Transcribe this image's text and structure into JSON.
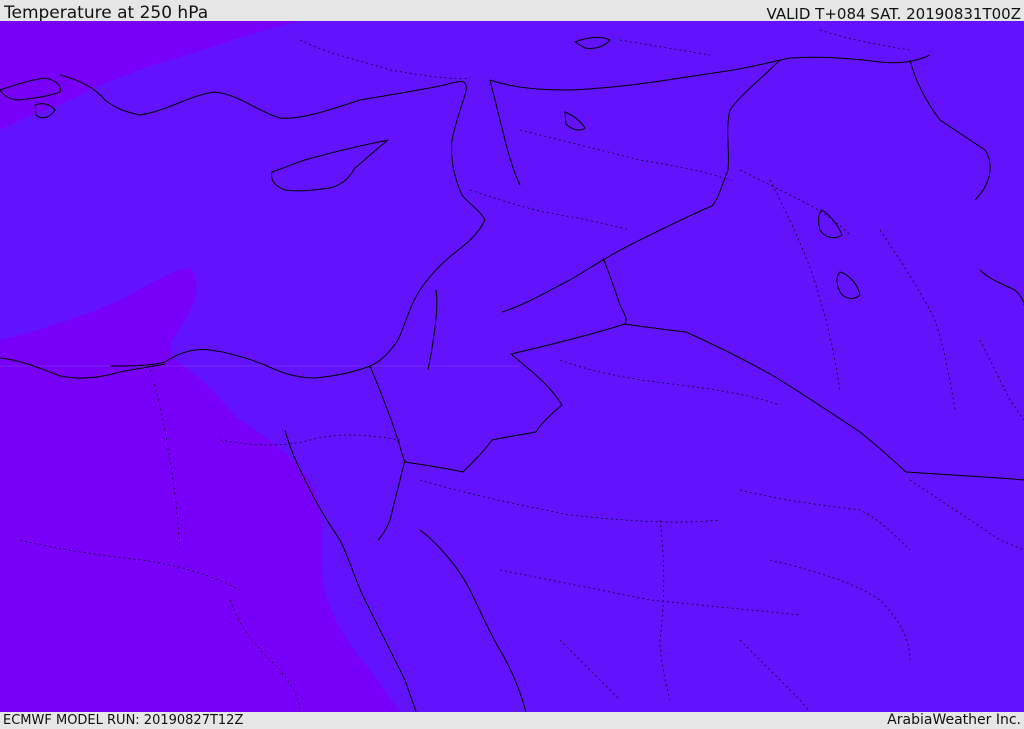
{
  "header": {
    "title": "Temperature at 250 hPa",
    "valid_time": "VALID T+084 SAT. 20190831T00Z"
  },
  "footer": {
    "model_run": "ECMWF MODEL RUN: 20190827T12Z",
    "credit": "ArabiaWeather Inc."
  },
  "map": {
    "field": "temperature-250hPa",
    "colors": {
      "main_fill": "#6313fc",
      "warm_fill": "#7800f8",
      "coastline": "#000000",
      "borders": "#000000"
    }
  }
}
